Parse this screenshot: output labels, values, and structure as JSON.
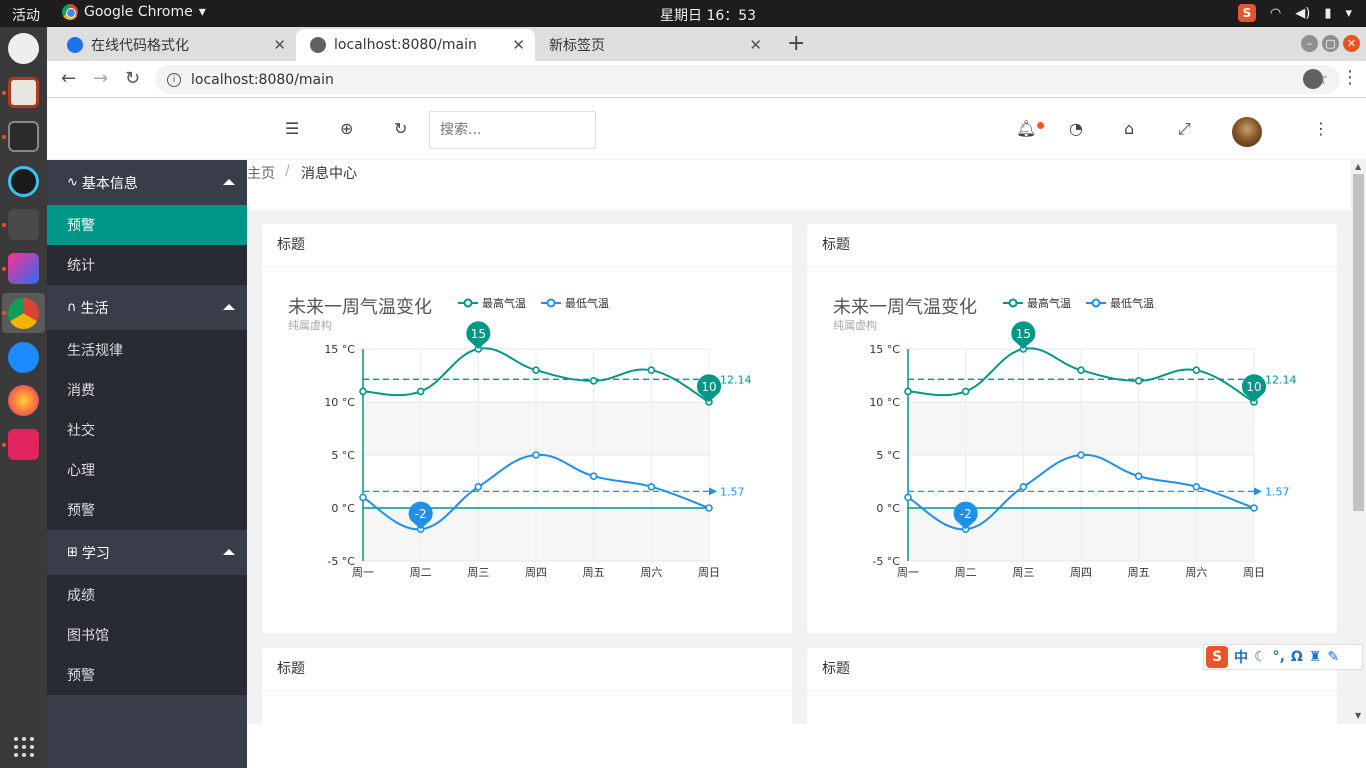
{
  "system": {
    "activities": "活动",
    "app_name": "Google Chrome",
    "clock": "星期日 16：53"
  },
  "browser": {
    "tabs": [
      {
        "label": "在线代码格式化"
      },
      {
        "label": "localhost:8080/main"
      },
      {
        "label": "新标签页"
      }
    ],
    "url": "localhost:8080/main"
  },
  "header": {
    "search_placeholder": "搜索..."
  },
  "sidebar": {
    "groups": [
      {
        "label": "基本信息",
        "items": [
          "预警",
          "统计"
        ]
      },
      {
        "label": "生活",
        "items": [
          "生活规律",
          "消费",
          "社交",
          "心理",
          "预警"
        ]
      },
      {
        "label": "学习",
        "items": [
          "成绩",
          "图书馆",
          "预警"
        ]
      }
    ]
  },
  "breadcrumb": {
    "home": "主页",
    "separator": "/",
    "current": "消息中心"
  },
  "cards": [
    {
      "title": "标题"
    },
    {
      "title": "标题"
    },
    {
      "title": "标题"
    },
    {
      "title": "标题"
    }
  ],
  "ime": {
    "mode": "中"
  },
  "colors": {
    "accent": "#009688",
    "high_series": "#009688",
    "low_series": "#1e90e8",
    "sidebar_bg": "#393d49",
    "notify_dot": "#ff5722"
  },
  "chart_data": [
    {
      "type": "line",
      "title": "未来一周气温变化",
      "subtitle": "纯属虚构",
      "categories": [
        "周一",
        "周二",
        "周三",
        "周四",
        "周五",
        "周六",
        "周日"
      ],
      "series": [
        {
          "name": "最高气温",
          "values": [
            11,
            11,
            15,
            13,
            12,
            13,
            10
          ],
          "markPoint": {
            "max": 15,
            "min": 10
          },
          "markLine": {
            "average": 12.14
          }
        },
        {
          "name": "最低气温",
          "values": [
            1,
            -2,
            2,
            5,
            3,
            2,
            0
          ],
          "markPoint": {
            "min": -2
          },
          "markLine": {
            "average": 1.57
          }
        }
      ],
      "ylim": [
        -5,
        15
      ],
      "yticks": [
        "-5 °C",
        "0 °C",
        "5 °C",
        "10 °C",
        "15 °C"
      ],
      "legend": "top",
      "grid": true
    },
    {
      "type": "line",
      "title": "未来一周气温变化",
      "subtitle": "纯属虚构",
      "categories": [
        "周一",
        "周二",
        "周三",
        "周四",
        "周五",
        "周六",
        "周日"
      ],
      "series": [
        {
          "name": "最高气温",
          "values": [
            11,
            11,
            15,
            13,
            12,
            13,
            10
          ],
          "markPoint": {
            "max": 15,
            "min": 10
          },
          "markLine": {
            "average": 12.14
          }
        },
        {
          "name": "最低气温",
          "values": [
            1,
            -2,
            2,
            5,
            3,
            2,
            0
          ],
          "markPoint": {
            "min": -2
          },
          "markLine": {
            "average": 1.57
          }
        }
      ],
      "ylim": [
        -5,
        15
      ],
      "yticks": [
        "-5 °C",
        "0 °C",
        "5 °C",
        "10 °C",
        "15 °C"
      ],
      "legend": "top",
      "grid": true
    }
  ]
}
